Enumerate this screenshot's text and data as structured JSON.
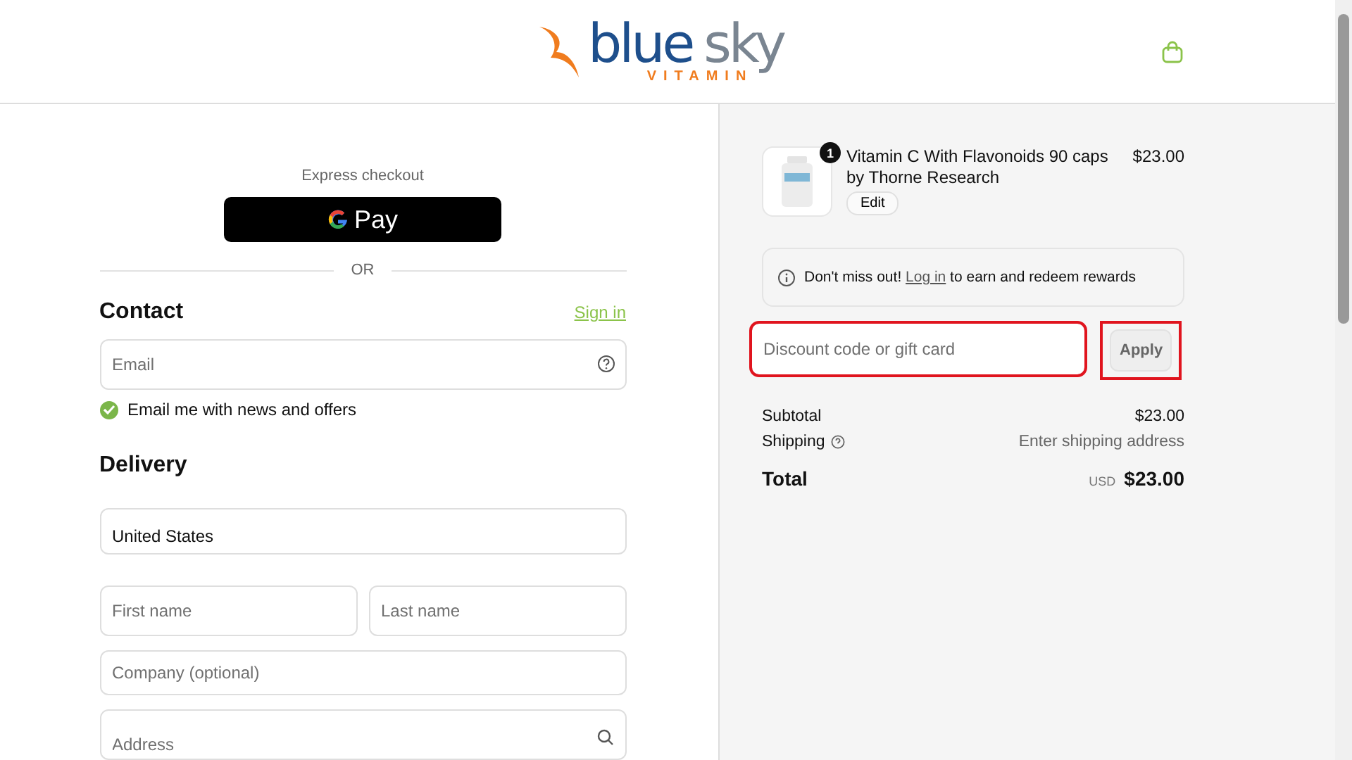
{
  "header": {
    "logo": {
      "word_1": "blue",
      "word_2": "sky",
      "tagline": "VITAMIN"
    }
  },
  "checkout": {
    "express_label": "Express checkout",
    "gpay_label": "Pay",
    "divider_label": "OR",
    "contact": {
      "title": "Contact",
      "sign_in": "Sign in",
      "email": {
        "placeholder": "Email"
      },
      "newsletter": {
        "label": "Email me with news and offers",
        "checked": true
      }
    },
    "delivery": {
      "title": "Delivery",
      "country": {
        "value": "United States"
      },
      "fields": [
        {
          "placeholder": "First name",
          "kind": "half"
        },
        {
          "placeholder": "Last name",
          "kind": "half"
        },
        {
          "placeholder": "Company (optional)",
          "kind": "full"
        },
        {
          "placeholder": "Address",
          "kind": "search"
        }
      ]
    }
  },
  "summary": {
    "items": [
      {
        "name": "Vitamin C With Flavonoids 90 caps by Thorne Research",
        "quantity": "1",
        "price": "$23.00",
        "edit": "Edit"
      }
    ],
    "rewards": {
      "before": "Don't miss out!",
      "link": "Log in",
      "after": "to earn and redeem rewards"
    },
    "discount": {
      "placeholder": "Discount code or gift card",
      "button": "Apply",
      "highlighted": true
    },
    "subtotal": {
      "label": "Subtotal",
      "value": "$23.00"
    },
    "shipping": {
      "label": "Shipping",
      "value": "Enter shipping address"
    },
    "total": {
      "label": "Total",
      "currency": "USD",
      "value": "$23.00"
    }
  }
}
